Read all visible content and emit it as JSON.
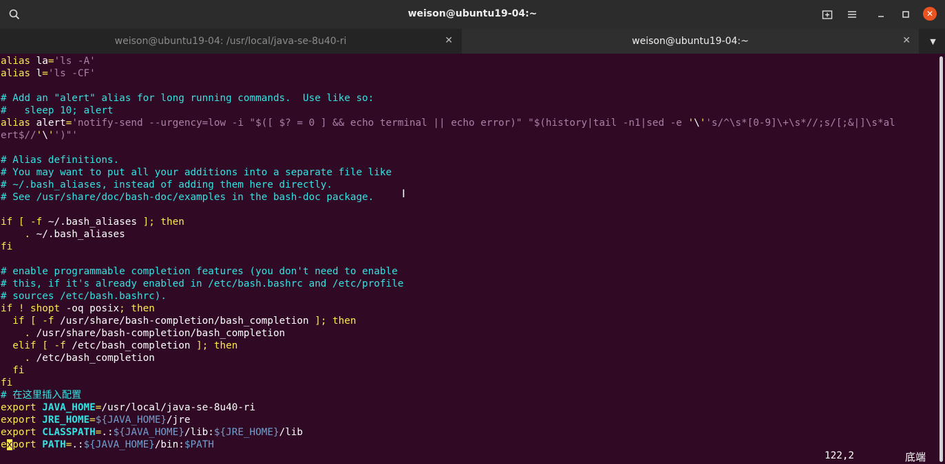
{
  "window": {
    "title": "weison@ubuntu19-04:~"
  },
  "tabs": [
    {
      "label": "weison@ubuntu19-04: /usr/local/java-se-8u40-ri",
      "active": false
    },
    {
      "label": "weison@ubuntu19-04:~",
      "active": true
    }
  ],
  "icons": {
    "search": "search-icon",
    "new_tab": "new-tab-icon",
    "menu": "hamburger-menu-icon",
    "minimize": "minimize-icon",
    "maximize": "maximize-icon",
    "close": "close-icon",
    "tab_menu": "chevron-down-icon"
  },
  "colors": {
    "terminal_bg": "#300a24",
    "keyword": "#fce94f",
    "comment": "#34e2e2",
    "string": "#ad7fa8",
    "variable": "#729fcf",
    "accent": "#e95420"
  },
  "editor": {
    "lines": [
      "alias la='ls -A'",
      "alias l='ls -CF'",
      "",
      "# Add an \"alert\" alias for long running commands.  Use like so:",
      "#   sleep 10; alert",
      "alias alert='notify-send --urgency=low -i \"$([ $? = 0 ] && echo terminal || echo error)\" \"$(history|tail -n1|sed -e '\\''s/^\\s*[0-9]\\+\\s*//;s/[;&|]\\s*al",
      "ert$//'\\'')\"'",
      "",
      "# Alias definitions.",
      "# You may want to put all your additions into a separate file like",
      "# ~/.bash_aliases, instead of adding them here directly.",
      "# See /usr/share/doc/bash-doc/examples in the bash-doc package.",
      "",
      "if [ -f ~/.bash_aliases ]; then",
      "    . ~/.bash_aliases",
      "fi",
      "",
      "# enable programmable completion features (you don't need to enable",
      "# this, if it's already enabled in /etc/bash.bashrc and /etc/profile",
      "# sources /etc/bash.bashrc).",
      "if ! shopt -oq posix; then",
      "  if [ -f /usr/share/bash-completion/bash_completion ]; then",
      "    . /usr/share/bash-completion/bash_completion",
      "  elif [ -f /etc/bash_completion ]; then",
      "    . /etc/bash_completion",
      "  fi",
      "fi",
      "# 在这里插入配置",
      "export JAVA_HOME=/usr/local/java-se-8u40-ri",
      "export JRE_HOME=${JAVA_HOME}/jre",
      "export CLASSPATH=.:${JAVA_HOME}/lib:${JRE_HOME}/lib",
      "export PATH=.:${JAVA_HOME}/bin:$PATH"
    ]
  },
  "status": {
    "cursor_position": "122,2",
    "scroll_position": "底端"
  }
}
